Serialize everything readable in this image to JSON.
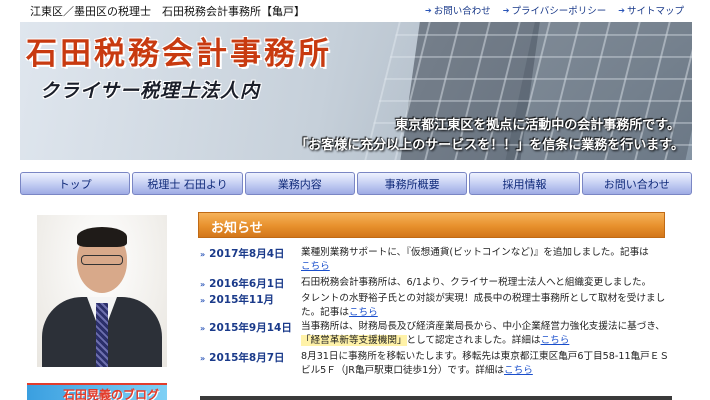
{
  "topbar": {
    "breadcrumb": "江東区／墨田区の税理士　石田税務会計事務所【亀戸】",
    "links": [
      "お問い合わせ",
      "プライバシーポリシー",
      "サイトマップ"
    ]
  },
  "header": {
    "title": "石田税務会計事務所",
    "subtitle": "クライサー税理士法人内",
    "tagline1": "東京都江東区を拠点に活動中の会計事務所です。",
    "tagline2": "「お客様に充分以上のサービスを！！」を信条に業務を行います。"
  },
  "nav": [
    "トップ",
    "税理士 石田より",
    "業務内容",
    "事務所概要",
    "採用情報",
    "お問い合わせ"
  ],
  "news": {
    "heading": "お知らせ",
    "items": [
      {
        "date": "2017年8月4日",
        "text": "業種別業務サポートに、『仮想通貨(ビットコインなど)』を追加しました。記事は",
        "link": "こちら"
      },
      {
        "date": "2016年6月1日",
        "text": "石田税務会計事務所は、6/1より、クライサー税理士法人へと組織変更しました。",
        "link": ""
      },
      {
        "date": "2015年11月",
        "text": "タレントの水野裕子氏との対談が実現！成長中の税理士事務所として取材を受けました。記事は",
        "link": "こちら"
      },
      {
        "date": "2015年9月14日",
        "text": "当事務所は、財務局長及び経済産業局長から、中小企業経営力強化支援法に基づき、",
        "highlight": "「経営革新等支援機関」",
        "text2": "として認定されました。詳細は",
        "link": "こちら"
      },
      {
        "date": "2015年8月7日",
        "text": "8月31日に事務所を移転いたします。移転先は東京都江東区亀戸6丁目58-11亀戸ＥＳビル5Ｆ（JR亀戸駅東口徒歩1分）です。詳細は",
        "link": "こちら"
      }
    ]
  },
  "blog": {
    "label": "石田晃義のブログ"
  }
}
